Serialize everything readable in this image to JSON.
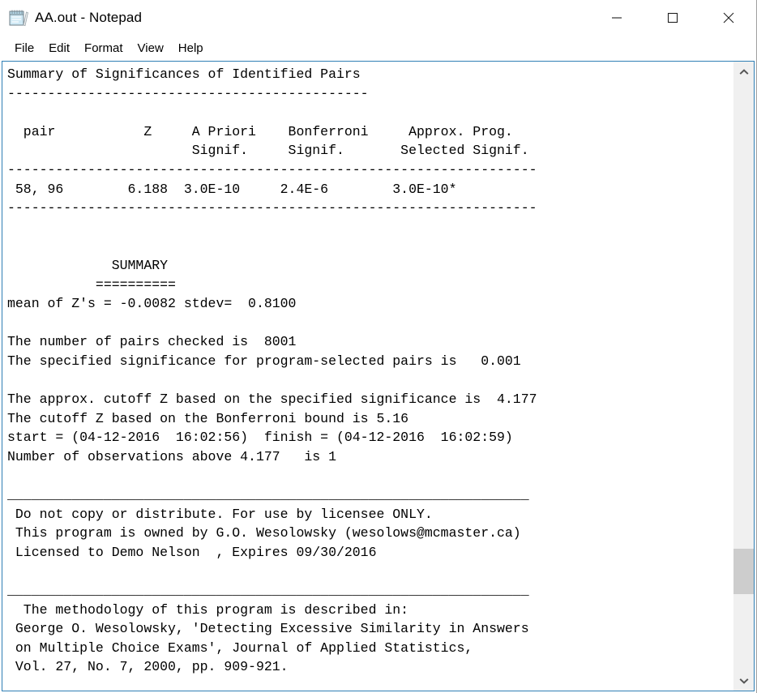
{
  "window": {
    "icon_name": "notepad-icon",
    "title": "AA.out - Notepad",
    "minimize_label": "Minimize",
    "maximize_label": "Maximize",
    "close_label": "Close"
  },
  "menubar": {
    "items": [
      {
        "label": "File"
      },
      {
        "label": "Edit"
      },
      {
        "label": "Format"
      },
      {
        "label": "View"
      },
      {
        "label": "Help"
      }
    ]
  },
  "scrollbar": {
    "up_arrow": "scroll-up-icon",
    "down_arrow": "scroll-down-icon",
    "thumb_position_pct": 86
  },
  "document": {
    "report": {
      "heading": "Summary of Significances of Identified Pairs",
      "heading_rule": "---------------------------------------------",
      "table": {
        "headers_line1": "  pair           Z     A Priori    Bonferroni     Approx. Prog.",
        "headers_line2": "                       Signif.     Signif.       Selected Signif.",
        "rule_top": "------------------------------------------------------------------",
        "rows": [
          " 58, 96        6.188  3.0E-10     2.4E-6        3.0E-10*"
        ],
        "rule_bottom": "------------------------------------------------------------------",
        "columns": [
          "pair",
          "Z",
          "A Priori Signif.",
          "Bonferroni Signif.",
          "Approx. Prog. Selected Signif."
        ],
        "row_values": [
          [
            "58, 96",
            "6.188",
            "3.0E-10",
            "2.4E-6",
            "3.0E-10*"
          ]
        ]
      },
      "summary": {
        "title": "             SUMMARY",
        "underline": "           ==========",
        "mean_line": "mean of Z's = -0.0082 stdev=  0.8100",
        "mean_of_z": "-0.0082",
        "stdev": "0.8100",
        "pairs_checked_line": "The number of pairs checked is  8001",
        "pairs_checked": "8001",
        "specified_significance_line": "The specified significance for program-selected pairs is   0.001",
        "specified_significance": "0.001",
        "approx_cutoff_line": "The approx. cutoff Z based on the specified significance is  4.177",
        "approx_cutoff": "4.177",
        "bonferroni_cutoff_line": "The cutoff Z based on the Bonferroni bound is 5.16",
        "bonferroni_cutoff": "5.16",
        "timing_line": "start = (04-12-2016  16:02:56)  finish = (04-12-2016  16:02:59)",
        "start_time": "04-12-2016  16:02:56",
        "finish_time": "04-12-2016  16:02:59",
        "observations_line": "Number of observations above 4.177   is 1",
        "observations_above": "1"
      },
      "license": {
        "rule": "_________________________________________________________________",
        "line1": " Do not copy or distribute. For use by licensee ONLY.",
        "line2": " This program is owned by G.O. Wesolowsky (wesolows@mcmaster.ca)",
        "line3": " Licensed to Demo Nelson  , Expires 09/30/2016"
      },
      "citation": {
        "rule": "_________________________________________________________________",
        "line1": "  The methodology of this program is described in:",
        "line2": " George O. Wesolowsky, 'Detecting Excessive Similarity in Answers",
        "line3": " on Multiple Choice Exams', Journal of Applied Statistics,",
        "line4": " Vol. 27, No. 7, 2000, pp. 909-921."
      }
    }
  }
}
